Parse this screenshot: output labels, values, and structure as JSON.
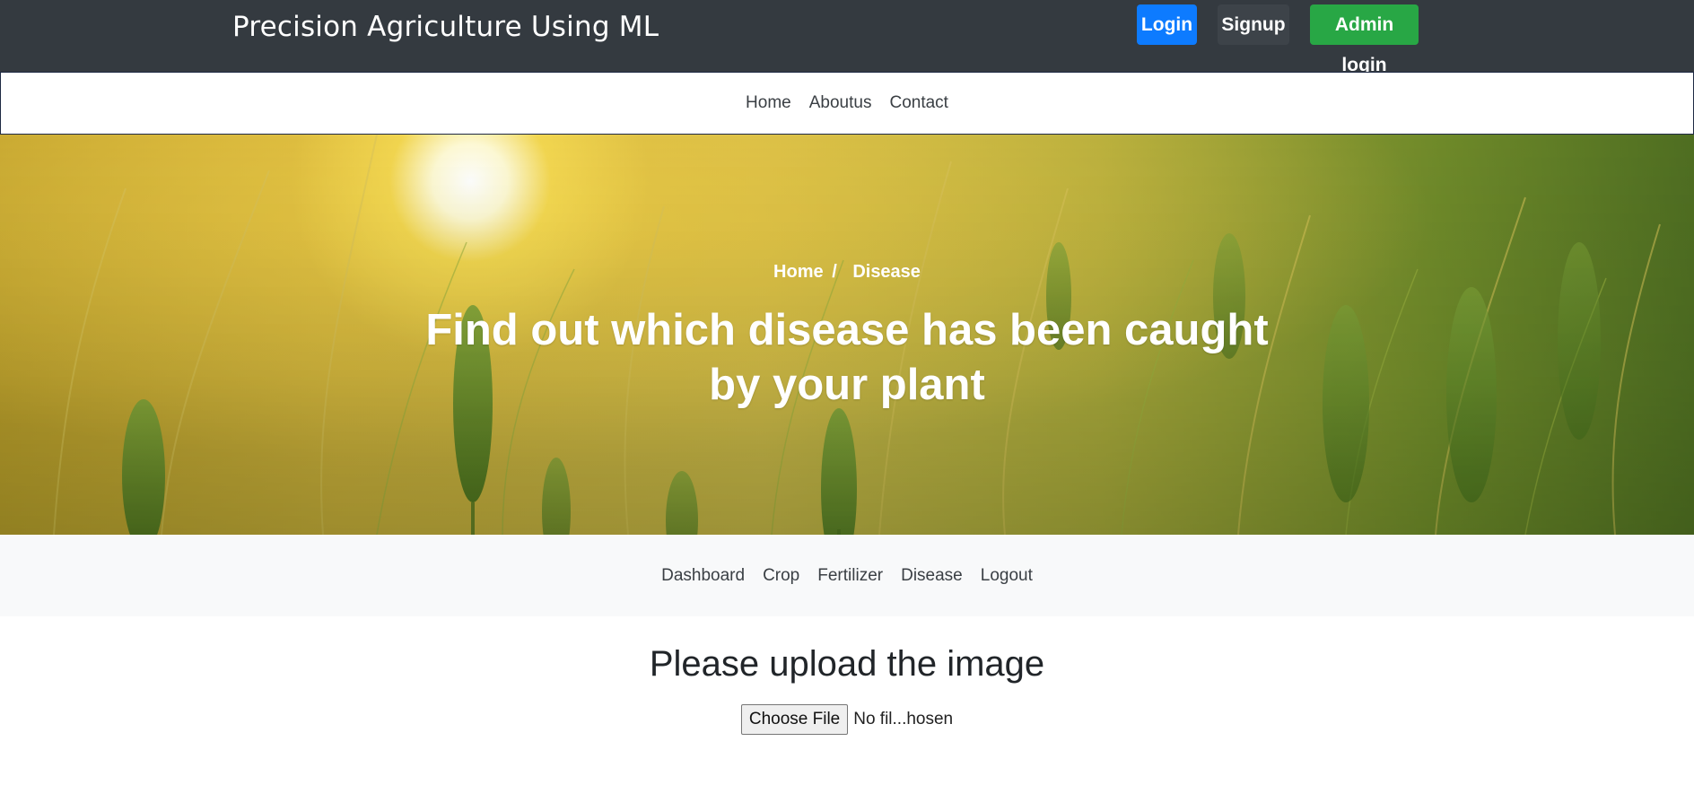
{
  "header": {
    "brand": "Precision Agriculture Using ML",
    "buttons": {
      "login": "Login",
      "signup": "Signup",
      "admin_login": "Admin login"
    }
  },
  "main_nav": [
    "Home",
    "Aboutus",
    "Contact"
  ],
  "hero": {
    "breadcrumb": {
      "home": "Home",
      "separator": "/",
      "current": "Disease"
    },
    "title_line1": "Find out which disease has been caught",
    "title_line2": "by your plant"
  },
  "sub_nav": [
    "Dashboard",
    "Crop",
    "Fertilizer",
    "Disease",
    "Logout"
  ],
  "upload": {
    "heading": "Please upload the image",
    "choose_label": "Choose File",
    "status": "No fil...hosen"
  },
  "colors": {
    "topbar": "#343a40",
    "login": "#0d7bff",
    "signup": "#3d4349",
    "admin": "#28a745",
    "subnav_bg": "#f8f9fa"
  }
}
